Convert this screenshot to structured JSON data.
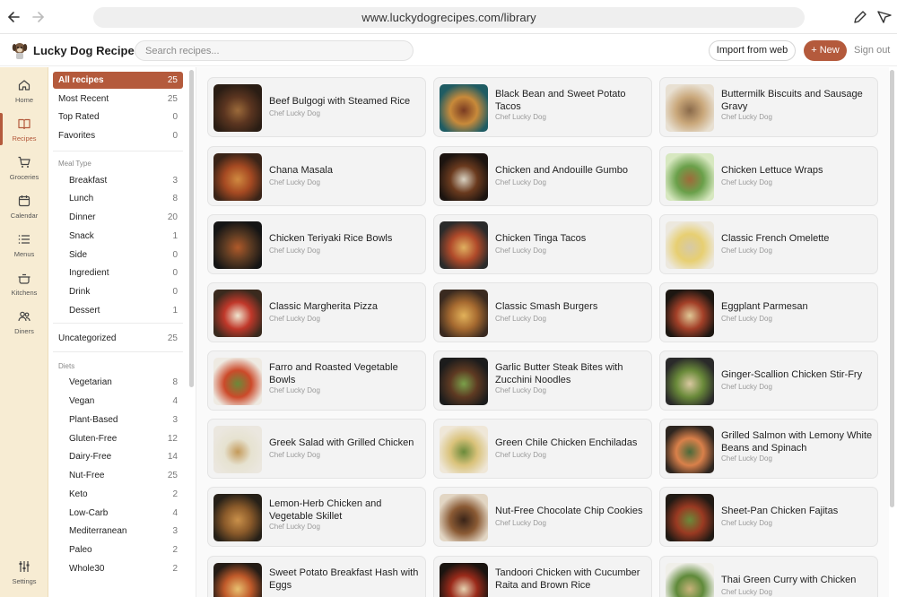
{
  "browser": {
    "url": "www.luckydogrecipes.com/library",
    "back_icon": "arrow-left-icon",
    "forward_icon": "arrow-right-icon",
    "tools": [
      "pen-icon",
      "send-icon"
    ]
  },
  "header": {
    "app_name": "Lucky Dog Recipes",
    "search_placeholder": "Search recipes...",
    "import_label": "Import from web",
    "new_label": "+ New",
    "signout_label": "Sign out"
  },
  "colors": {
    "accent": "#b45a3c",
    "rail_bg": "#f7ecd3"
  },
  "rail": [
    {
      "label": "Home",
      "icon": "home-icon"
    },
    {
      "label": "Recipes",
      "icon": "book-icon",
      "active": true
    },
    {
      "label": "Groceries",
      "icon": "cart-icon"
    },
    {
      "label": "Calendar",
      "icon": "calendar-icon"
    },
    {
      "label": "Menus",
      "icon": "list-icon"
    },
    {
      "label": "Kitchens",
      "icon": "pot-icon"
    },
    {
      "label": "Diners",
      "icon": "people-icon"
    },
    {
      "label": "Settings",
      "icon": "sliders-icon"
    }
  ],
  "sidebar": {
    "top": [
      {
        "label": "All recipes",
        "count": "25",
        "active": true
      },
      {
        "label": "Most Recent",
        "count": "25"
      },
      {
        "label": "Top Rated",
        "count": "0"
      },
      {
        "label": "Favorites",
        "count": "0"
      }
    ],
    "meal_type_header": "Meal Type",
    "meal_types": [
      {
        "label": "Breakfast",
        "count": "3"
      },
      {
        "label": "Lunch",
        "count": "8"
      },
      {
        "label": "Dinner",
        "count": "20"
      },
      {
        "label": "Snack",
        "count": "1"
      },
      {
        "label": "Side",
        "count": "0"
      },
      {
        "label": "Ingredient",
        "count": "0"
      },
      {
        "label": "Drink",
        "count": "0"
      },
      {
        "label": "Dessert",
        "count": "1"
      }
    ],
    "uncategorized": {
      "label": "Uncategorized",
      "count": "25"
    },
    "diets_header": "Diets",
    "diets": [
      {
        "label": "Vegetarian",
        "count": "8"
      },
      {
        "label": "Vegan",
        "count": "4"
      },
      {
        "label": "Plant-Based",
        "count": "3"
      },
      {
        "label": "Gluten-Free",
        "count": "12"
      },
      {
        "label": "Dairy-Free",
        "count": "14"
      },
      {
        "label": "Nut-Free",
        "count": "25"
      },
      {
        "label": "Keto",
        "count": "2"
      },
      {
        "label": "Low-Carb",
        "count": "4"
      },
      {
        "label": "Mediterranean",
        "count": "3"
      },
      {
        "label": "Paleo",
        "count": "2"
      },
      {
        "label": "Whole30",
        "count": "2"
      }
    ]
  },
  "recipes": [
    {
      "title": "Beef Bulgogi with Steamed Rice",
      "author": "Chef Lucky Dog"
    },
    {
      "title": "Black Bean and Sweet Potato Tacos",
      "author": "Chef Lucky Dog"
    },
    {
      "title": "Buttermilk Biscuits and Sausage Gravy",
      "author": "Chef Lucky Dog"
    },
    {
      "title": "Chana Masala",
      "author": "Chef Lucky Dog"
    },
    {
      "title": "Chicken and Andouille Gumbo",
      "author": "Chef Lucky Dog"
    },
    {
      "title": "Chicken Lettuce Wraps",
      "author": "Chef Lucky Dog"
    },
    {
      "title": "Chicken Teriyaki Rice Bowls",
      "author": "Chef Lucky Dog"
    },
    {
      "title": "Chicken Tinga Tacos",
      "author": "Chef Lucky Dog"
    },
    {
      "title": "Classic French Omelette",
      "author": "Chef Lucky Dog"
    },
    {
      "title": "Classic Margherita Pizza",
      "author": "Chef Lucky Dog"
    },
    {
      "title": "Classic Smash Burgers",
      "author": "Chef Lucky Dog"
    },
    {
      "title": "Eggplant Parmesan",
      "author": "Chef Lucky Dog"
    },
    {
      "title": "Farro and Roasted Vegetable Bowls",
      "author": "Chef Lucky Dog"
    },
    {
      "title": "Garlic Butter Steak Bites with Zucchini Noodles",
      "author": "Chef Lucky Dog"
    },
    {
      "title": "Ginger-Scallion Chicken Stir-Fry",
      "author": "Chef Lucky Dog"
    },
    {
      "title": "Greek Salad with Grilled Chicken",
      "author": "Chef Lucky Dog"
    },
    {
      "title": "Green Chile Chicken Enchiladas",
      "author": "Chef Lucky Dog"
    },
    {
      "title": "Grilled Salmon with Lemony White Beans and Spinach",
      "author": "Chef Lucky Dog"
    },
    {
      "title": "Lemon-Herb Chicken and Vegetable Skillet",
      "author": "Chef Lucky Dog"
    },
    {
      "title": "Nut-Free Chocolate Chip Cookies",
      "author": "Chef Lucky Dog"
    },
    {
      "title": "Sheet-Pan Chicken Fajitas",
      "author": "Chef Lucky Dog"
    },
    {
      "title": "Sweet Potato Breakfast Hash with Eggs",
      "author": ""
    },
    {
      "title": "Tandoori Chicken with Cucumber Raita and Brown Rice",
      "author": ""
    },
    {
      "title": "Thai Green Curry with Chicken",
      "author": "Chef Lucky Dog"
    }
  ]
}
